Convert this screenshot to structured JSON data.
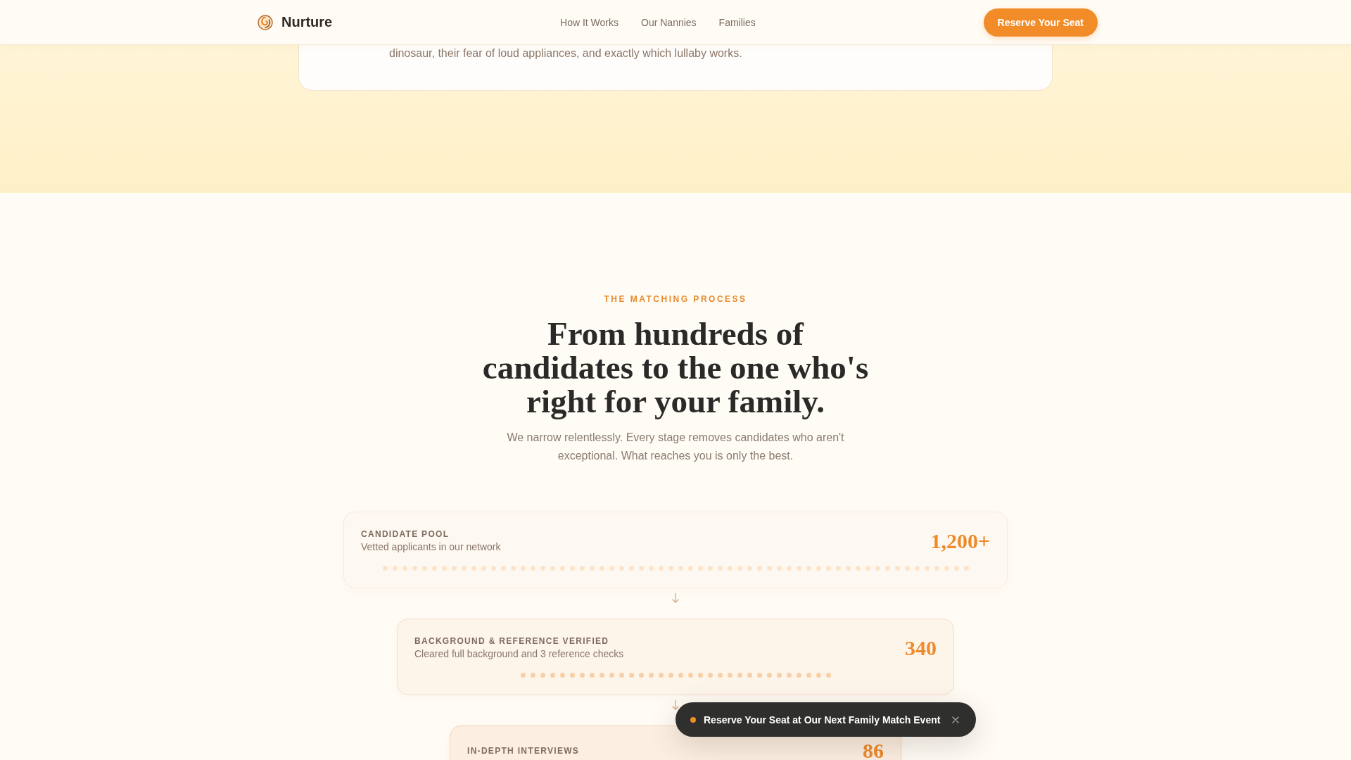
{
  "header": {
    "brand": "Nurture",
    "nav": [
      {
        "label": "How It Works"
      },
      {
        "label": "Our Nannies"
      },
      {
        "label": "Families"
      }
    ],
    "cta": "Reserve Your Seat"
  },
  "intro_card": {
    "text": "dinosaur, their fear of loud appliances, and exactly which lullaby works."
  },
  "process": {
    "eyebrow": "THE MATCHING PROCESS",
    "title": "From hundreds of candidates to the one who's right for your family.",
    "subtitle": "We narrow relentlessly. Every stage removes candidates who aren't exceptional. What reaches you is only the best."
  },
  "stages": [
    {
      "label": "CANDIDATE POOL",
      "description": "Vetted applicants in our network",
      "count": "1,200+"
    },
    {
      "label": "BACKGROUND & REFERENCE VERIFIED",
      "description": "Cleared full background and 3 reference checks",
      "count": "340"
    },
    {
      "label": "IN-DEPTH INTERVIEWS",
      "count": "86"
    }
  ],
  "toast": {
    "text": "Reserve Your Seat at Our Next Family Match Event"
  }
}
